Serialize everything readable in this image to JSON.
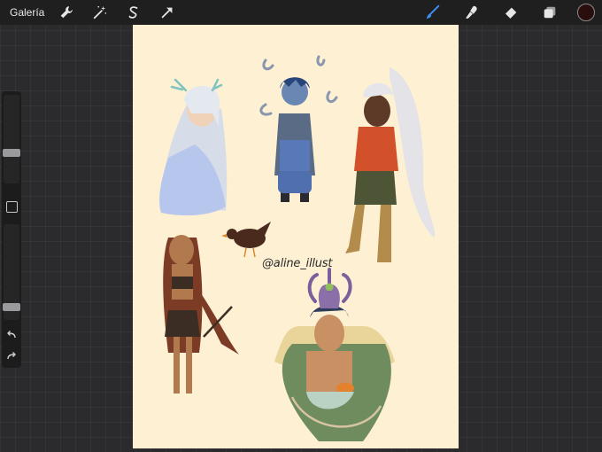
{
  "topbar": {
    "gallery_label": "Galería",
    "left_tools": [
      "wrench-icon",
      "magic-wand-icon",
      "selection-icon",
      "transform-arrow-icon"
    ],
    "right_tools": [
      "brush-icon",
      "smudge-icon",
      "eraser-icon",
      "layers-icon"
    ],
    "active_tool": "brush-icon",
    "current_color": "#2a0d0d",
    "accent_color": "#3d8df0"
  },
  "sidebar": {
    "brush_size_level": 0.33,
    "opacity_level": 0.1
  },
  "canvas": {
    "background_color": "#fdf0d3",
    "signature": "@aline_illust"
  }
}
